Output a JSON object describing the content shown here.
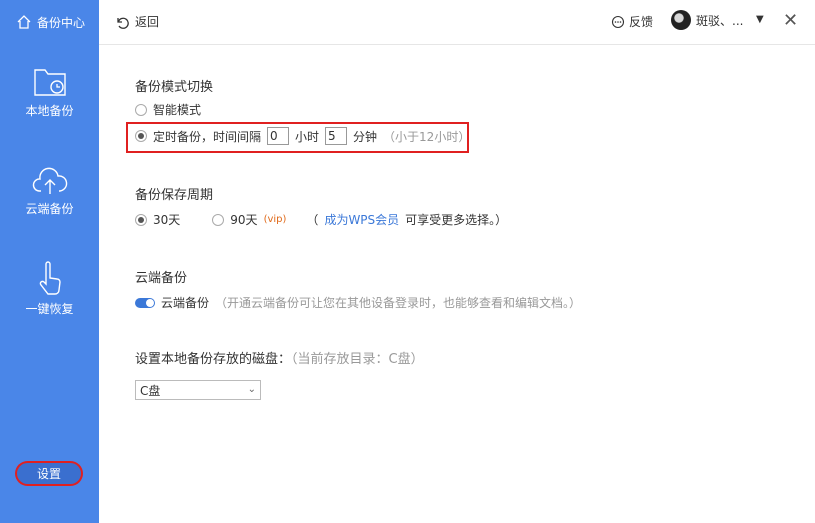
{
  "sidebar": {
    "brand": "备份中心",
    "items": [
      {
        "label": "本地备份",
        "icon": "folder-clock-icon"
      },
      {
        "label": "云端备份",
        "icon": "cloud-upload-icon"
      },
      {
        "label": "一键恢复",
        "icon": "hand-pointer-icon"
      }
    ],
    "settings_label": "设置"
  },
  "topbar": {
    "back_label": "返回",
    "feedback_label": "反馈",
    "username": "斑驳、..."
  },
  "backup_mode": {
    "title": "备份模式切换",
    "smart_label": "智能模式",
    "timed_prefix": "定时备份，时间间隔",
    "hours_value": "0",
    "hours_unit": "小时",
    "minutes_value": "5",
    "minutes_unit": "分钟",
    "hint": "（小于12小时）",
    "selected": "timed"
  },
  "retention": {
    "title": "备份保存周期",
    "opt30": "30天",
    "opt90": "90天",
    "vip_tag": "(vip)",
    "paren_open": "（",
    "member_link": "成为WPS会员",
    "member_tail": "可享受更多选择。）",
    "selected": "30"
  },
  "cloud": {
    "title": "云端备份",
    "toggle_label": "云端备份",
    "toggle_on": true,
    "desc": "（开通云端备份可让您在其他设备登录时，也能够查看和编辑文档。）"
  },
  "disk": {
    "title": "设置本地备份存放的磁盘：",
    "current": "（当前存放目录：C盘）",
    "selected_value": "C盘"
  },
  "colors": {
    "sidebar": "#4a86e8",
    "accent": "#3b78d8",
    "highlight": "#e02020"
  }
}
